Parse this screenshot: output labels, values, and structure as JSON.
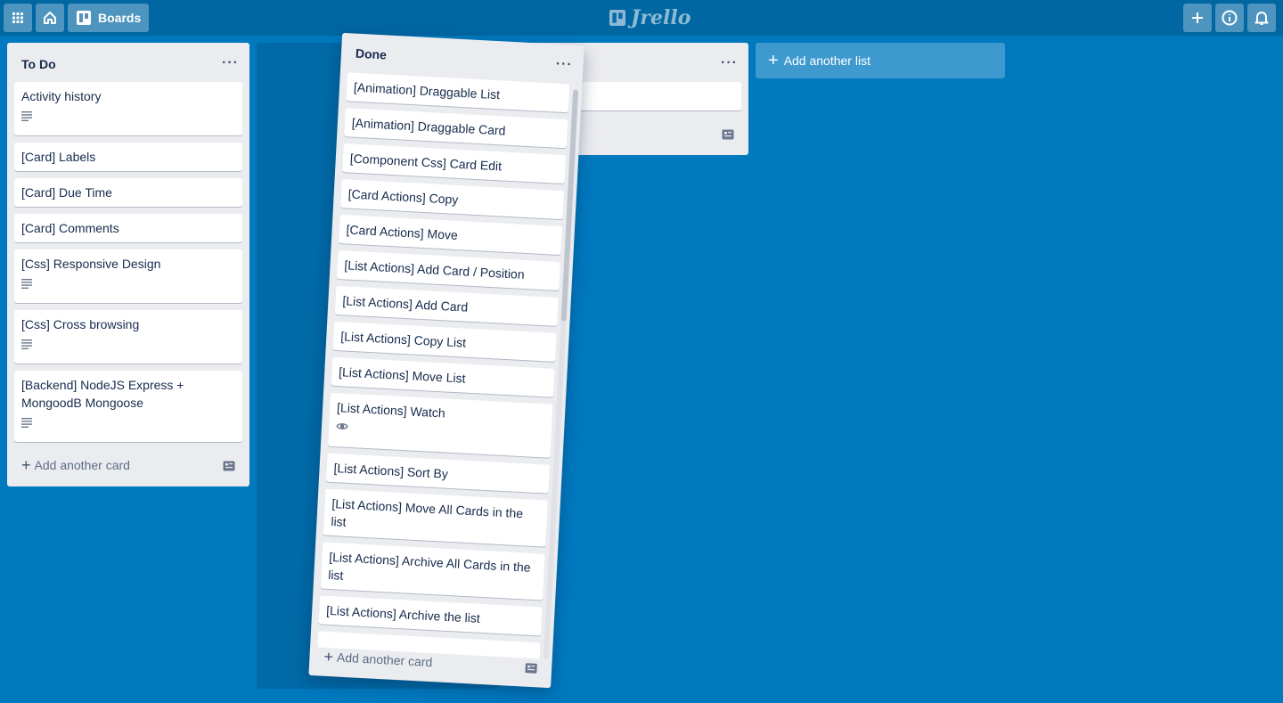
{
  "header": {
    "boards_label": "Boards",
    "logo_text": "Jrello",
    "icons": [
      "apps-grid-icon",
      "home-icon",
      "boards-icon",
      "plus-icon",
      "info-icon",
      "bell-icon"
    ]
  },
  "lists": {
    "todo": {
      "title": "To Do",
      "cards": [
        {
          "title": "Activity history",
          "has_description": true
        },
        {
          "title": "[Card] Labels"
        },
        {
          "title": "[Card] Due Time"
        },
        {
          "title": "[Card] Comments"
        },
        {
          "title": "[Css] Responsive Design",
          "has_description": true
        },
        {
          "title": "[Css] Cross browsing",
          "has_description": true
        },
        {
          "title": "[Backend] NodeJS Express + MongoodB Mongoose",
          "has_description": true
        }
      ],
      "add_card_label": "Add another card"
    },
    "hidden": {
      "partial_add_text": "ard"
    },
    "done": {
      "title": "Done",
      "cards": [
        {
          "title": "[Animation] Draggable List"
        },
        {
          "title": "[Animation] Draggable Card"
        },
        {
          "title": "[Component Css] Card Edit"
        },
        {
          "title": "[Card Actions] Copy"
        },
        {
          "title": "[Card Actions] Move"
        },
        {
          "title": "[List Actions] Add Card / Position"
        },
        {
          "title": "[List Actions] Add Card"
        },
        {
          "title": "[List Actions] Copy List"
        },
        {
          "title": "[List Actions] Move List"
        },
        {
          "title": "[List Actions] Watch",
          "watched": true
        },
        {
          "title": "[List Actions] Sort By"
        },
        {
          "title": "[List Actions] Move All Cards in the list"
        },
        {
          "title": "[List Actions] Archive All Cards in the list"
        },
        {
          "title": "[List Actions] Archive the list"
        }
      ],
      "add_card_label": "Add another card"
    }
  },
  "add_list_label": "Add another list",
  "colors": {
    "board_bg": "#0079bf",
    "list_bg": "#ebecf0",
    "card_bg": "#ffffff",
    "text": "#172b4d"
  }
}
